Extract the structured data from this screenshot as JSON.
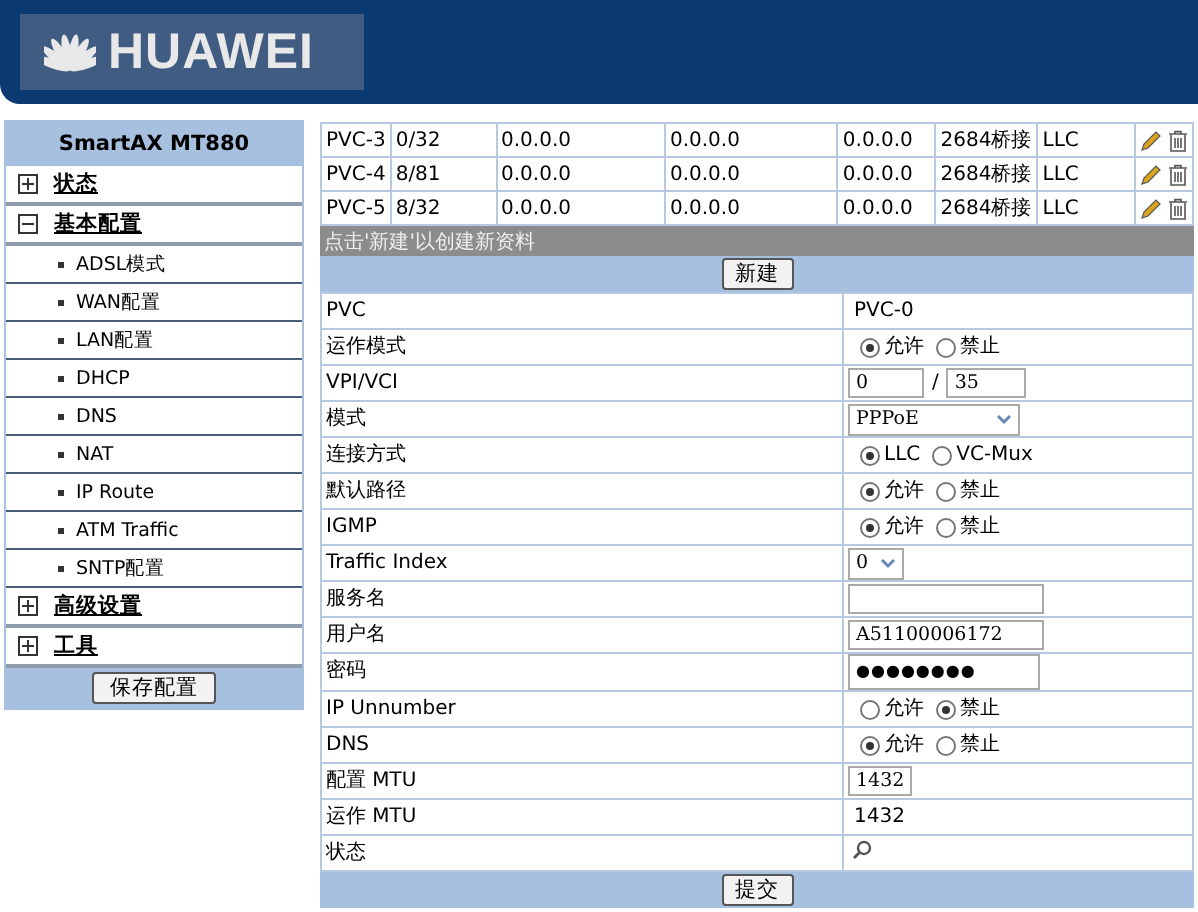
{
  "header": {
    "logo_text": "HUAWEI"
  },
  "sidebar": {
    "title": "SmartAX MT880",
    "items": [
      {
        "label": "状态",
        "expanded": false
      },
      {
        "label": "基本配置",
        "expanded": true,
        "children": [
          {
            "label": "ADSL模式"
          },
          {
            "label": "WAN配置"
          },
          {
            "label": "LAN配置"
          },
          {
            "label": "DHCP"
          },
          {
            "label": "DNS"
          },
          {
            "label": "NAT"
          },
          {
            "label": "IP Route"
          },
          {
            "label": "ATM Traffic"
          },
          {
            "label": "SNTP配置"
          }
        ]
      },
      {
        "label": "高级设置",
        "expanded": false
      },
      {
        "label": "工具",
        "expanded": false
      }
    ],
    "save_button": "保存配置"
  },
  "pvc_table": {
    "rows": [
      {
        "cells": [
          "PVC-3",
          "0/32",
          "0.0.0.0",
          "0.0.0.0",
          "0.0.0.0",
          "2684桥接",
          "LLC"
        ]
      },
      {
        "cells": [
          "PVC-4",
          "8/81",
          "0.0.0.0",
          "0.0.0.0",
          "0.0.0.0",
          "2684桥接",
          "LLC"
        ]
      },
      {
        "cells": [
          "PVC-5",
          "8/32",
          "0.0.0.0",
          "0.0.0.0",
          "0.0.0.0",
          "2684桥接",
          "LLC"
        ]
      }
    ],
    "hint": "点击'新建'以创建新资料",
    "new_button": "新建"
  },
  "form": {
    "rows": [
      {
        "label": "PVC",
        "kind": "text",
        "value": "PVC-0"
      },
      {
        "label": "运作模式",
        "kind": "radio",
        "options": [
          {
            "label": "允许",
            "selected": true
          },
          {
            "label": "禁止",
            "selected": false
          }
        ]
      },
      {
        "label": "VPI/VCI",
        "kind": "pair",
        "values": [
          "0",
          "35"
        ],
        "separator": "/"
      },
      {
        "label": "模式",
        "kind": "select",
        "value": "PPPoE"
      },
      {
        "label": "连接方式",
        "kind": "radio",
        "options": [
          {
            "label": "LLC",
            "selected": true
          },
          {
            "label": "VC-Mux",
            "selected": false
          }
        ]
      },
      {
        "label": "默认路径",
        "kind": "radio",
        "options": [
          {
            "label": "允许",
            "selected": true
          },
          {
            "label": "禁止",
            "selected": false
          }
        ]
      },
      {
        "label": "IGMP",
        "kind": "radio",
        "options": [
          {
            "label": "允许",
            "selected": true
          },
          {
            "label": "禁止",
            "selected": false
          }
        ]
      },
      {
        "label": "Traffic Index",
        "kind": "small-select",
        "value": "0"
      },
      {
        "label": "服务名",
        "kind": "input"
      },
      {
        "label": "用户名",
        "kind": "input",
        "value": "A51100006172"
      },
      {
        "label": "密码",
        "kind": "password",
        "value": "●●●●●●●●"
      },
      {
        "label": "IP Unnumber",
        "kind": "radio",
        "options": [
          {
            "label": "允许",
            "selected": false
          },
          {
            "label": "禁止",
            "selected": true
          }
        ]
      },
      {
        "label": "DNS",
        "kind": "radio",
        "options": [
          {
            "label": "允许",
            "selected": true
          },
          {
            "label": "禁止",
            "selected": false
          }
        ]
      },
      {
        "label": "配置 MTU",
        "kind": "short-input",
        "value": "1432"
      },
      {
        "label": "运作 MTU",
        "kind": "text",
        "value": "1432"
      },
      {
        "label": "状态",
        "kind": "status-icon"
      }
    ],
    "submit_button": "提交"
  }
}
